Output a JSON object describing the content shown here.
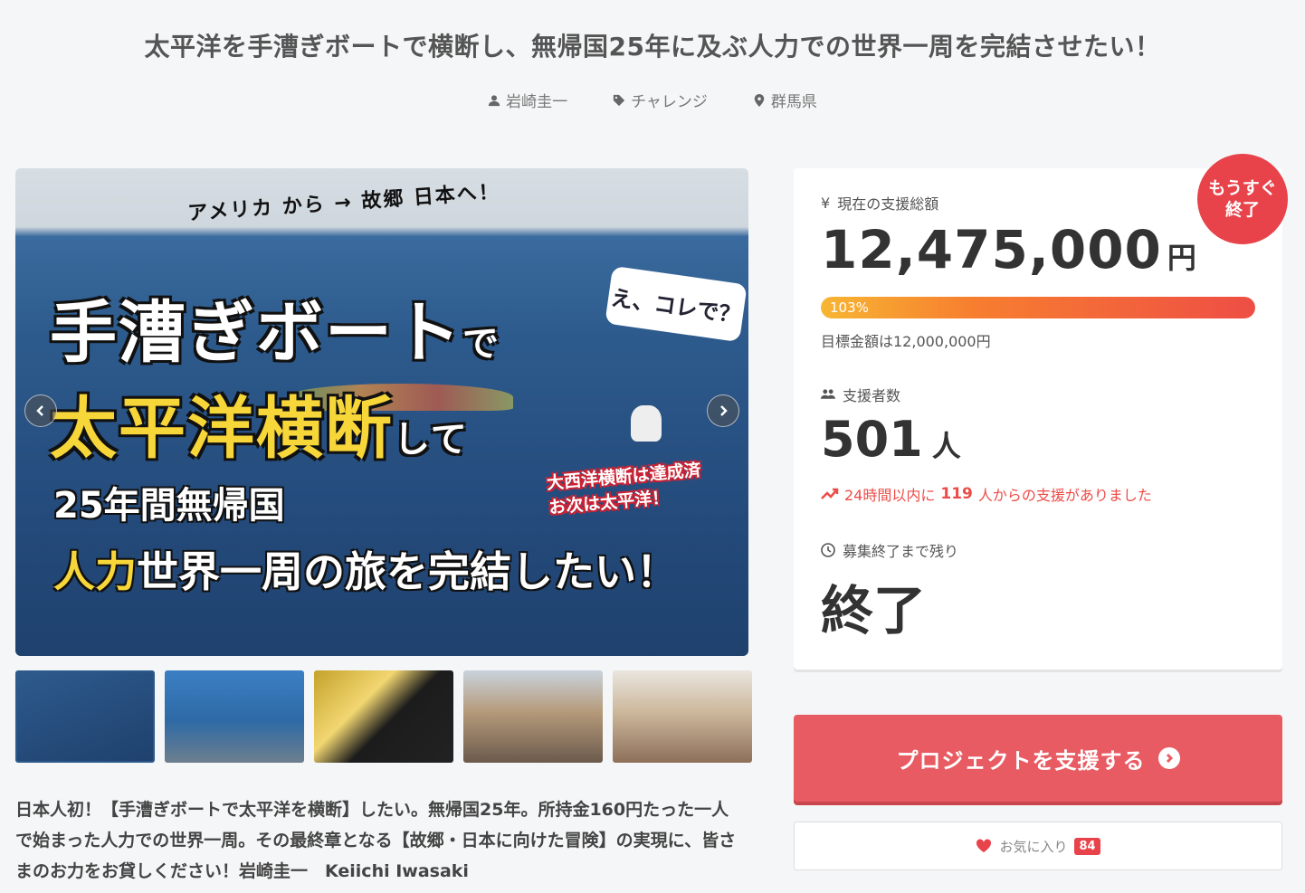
{
  "header": {
    "title": "太平洋を手漕ぎボートで横断し、無帰国25年に及ぶ人力での世界一周を完結させたい！",
    "owner": "岩崎圭一",
    "category": "チャレンジ",
    "location": "群馬県"
  },
  "hero": {
    "banner": "アメリカ から → 故郷 日本へ！",
    "line1": "手漕ぎボート",
    "line1_suffix": "で",
    "line2": "太平洋横断",
    "line2_suffix": "して",
    "line3": "25年間無帰国",
    "line4_yellow": "人力",
    "line4": "世界一周の旅を完結したい！",
    "bubble": "え、コレで？",
    "note_line1": "大西洋横断は達成済",
    "note_line2": "お次は太平洋！"
  },
  "description": "日本人初！【手漕ぎボートで太平洋を横断】したい。無帰国25年。所持金160円たった一人で始まった人力での世界一周。その最終章となる【故郷・日本に向けた冒険】の実現に、皆さまのお力をお貸しください！岩崎圭一　Keiichi Iwasaki",
  "stats": {
    "total_label": "現在の支援総額",
    "total_value": "12,475,000",
    "total_unit": "円",
    "progress_percent": 103,
    "progress_text": "103%",
    "goal_text": "目標金額は12,000,000円",
    "supporters_label": "支援者数",
    "supporters_value": "501",
    "supporters_unit": "人",
    "trend_prefix": "24時間以内に",
    "trend_count": "119",
    "trend_suffix": "人からの支援がありました",
    "remaining_label": "募集終了まで残り",
    "remaining_value": "終了",
    "badge_line1": "もうすぐ",
    "badge_line2": "終了"
  },
  "actions": {
    "support_label": "プロジェクトを支援する",
    "favorite_label": "お気に入り",
    "favorite_count": "84"
  },
  "colors": {
    "accent": "#e95b63",
    "badge": "#e8424a"
  }
}
